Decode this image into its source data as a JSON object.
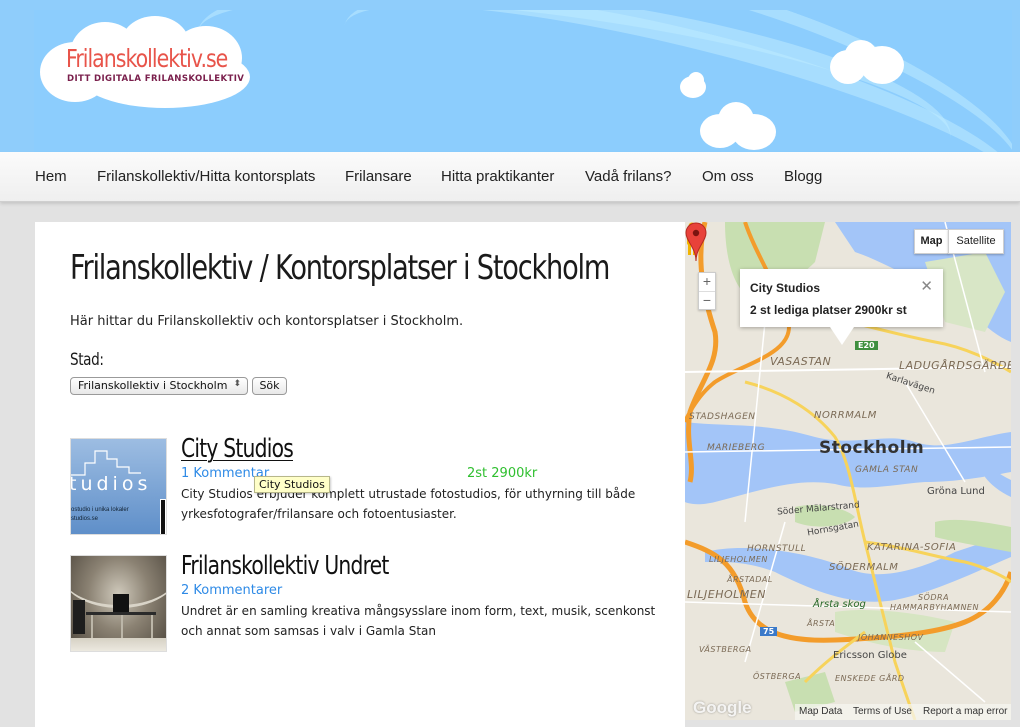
{
  "site": {
    "logo_title": "Frilanskollektiv.se",
    "logo_tagline": "DITT DIGITALA FRILANSKOLLEKTIV"
  },
  "nav": {
    "items": [
      {
        "label": "Hem"
      },
      {
        "label": "Frilanskollektiv/Hitta kontorsplats"
      },
      {
        "label": "Frilansare"
      },
      {
        "label": "Hitta praktikanter"
      },
      {
        "label": "Vadå frilans?"
      },
      {
        "label": "Om oss"
      },
      {
        "label": "Blogg"
      }
    ]
  },
  "main": {
    "title": "Frilanskollektiv / Kontorsplatser i Stockholm",
    "intro": "Här hittar du Frilanskollektiv och kontorsplatser i Stockholm.",
    "city_label": "Stad:",
    "city_select_value": "Frilanskollektiv i Stockholm",
    "search_button": "Sök",
    "listings": [
      {
        "title": "City Studios",
        "comments": "1 Kommentar",
        "price": "2st 2900kr",
        "description": "City Studios erbjuder komplett utrustade fotostudios, för uthyrning till både yrkesfotografer/frilansare och fotoentusiaster.",
        "thumb_word": "tudios",
        "thumb_tag_1": "ostudio i unika lokaler",
        "thumb_tag_2": "studios.se"
      },
      {
        "title": "Frilanskollektiv Undret",
        "comments": "2 Kommentarer",
        "description": "Undret är en samling kreativa mångsysslare inom form, text, musik, scenkonst och annat som samsas i valv i Gamla Stan"
      }
    ],
    "tooltip": "City Studios"
  },
  "map": {
    "type_buttons": [
      {
        "label": "Map",
        "active": true
      },
      {
        "label": "Satellite",
        "active": false
      }
    ],
    "zoom_in": "+",
    "zoom_out": "−",
    "info_window": {
      "title": "City Studios",
      "text": "2 st lediga platser 2900kr st",
      "close": "✕"
    },
    "labels": {
      "city": "Stockholm",
      "vasastan": "VASASTAN",
      "ladugardsgardet": "LADUGÅRDSGÄRDET",
      "karlavagen": "Karlavägen",
      "stadshagen": "STADSHAGEN",
      "norrmalm": "NORRMALM",
      "marieberg": "MARIEBERG",
      "gamla_stan": "GAMLA STAN",
      "grona_lund": "Gröna Lund",
      "soder_malarstrand": "Söder Mälarstrand",
      "hornsgatan": "Hornsgatan",
      "hornstull": "HORNSTULL",
      "katarina_sofia": "KATARINA-SOFIA",
      "sodermalm": "SÖDERMALM",
      "liljeholmen_small": "LILJEHOLMEN",
      "arstadal": "ÅRSTADAL",
      "liljeholmen": "LILJEHOLMEN",
      "arsta_skog": "Årsta skog",
      "sodra_hammarbyhamnen_1": "SÖDRA",
      "sodra_hammarbyhamnen_2": "HAMMARBYHAMNEN",
      "arsta": "ÅRSTA",
      "johanneshov": "JOHANNESHOV",
      "vastberga": "VÄSTBERGA",
      "ericsson_globe": "Ericsson Globe",
      "ostberga": "ÖSTBERGA",
      "enskede_gard": "ENSKEDE GÅRD",
      "e20": "E20",
      "r75": "75"
    },
    "footer": {
      "map_data": "Map Data",
      "terms": "Terms of Use",
      "report": "Report a map error"
    },
    "google": "Google"
  }
}
